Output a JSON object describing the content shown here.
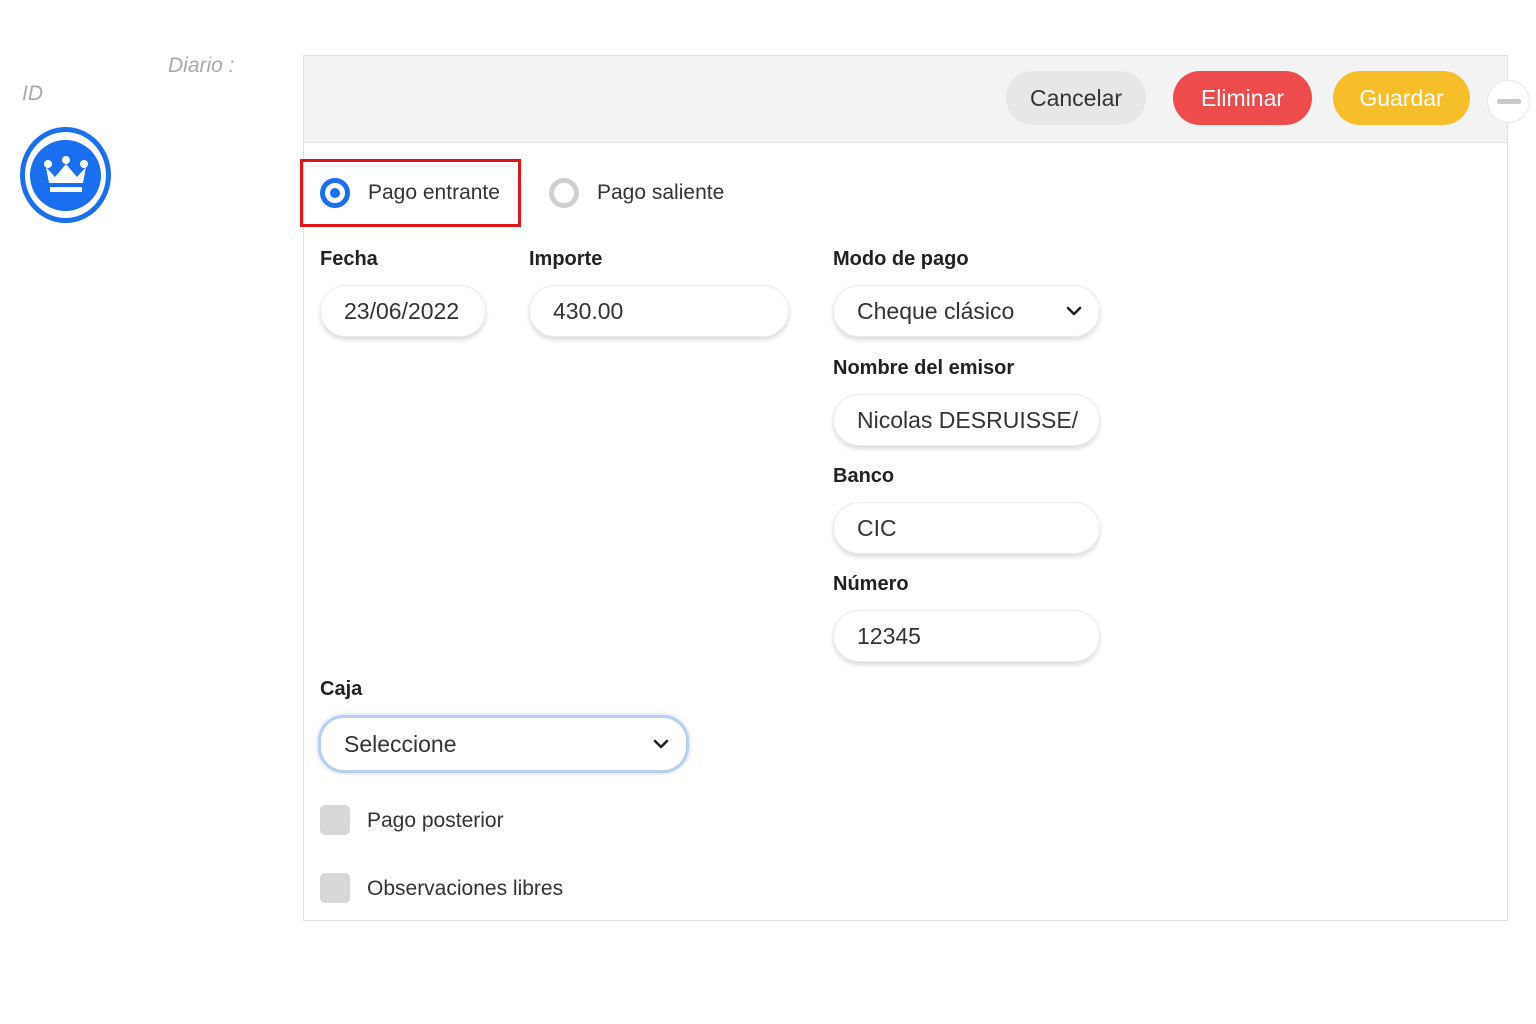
{
  "side": {
    "journal_label": "Diario :",
    "id_label": "ID",
    "badge_icon": "crown-icon"
  },
  "toolbar": {
    "cancel_label": "Cancelar",
    "delete_label": "Eliminar",
    "save_label": "Guardar",
    "collapse_icon": "minus-icon"
  },
  "payment_type": {
    "options": [
      {
        "label": "Pago entrante",
        "selected": true
      },
      {
        "label": "Pago saliente",
        "selected": false
      }
    ]
  },
  "fields": {
    "date": {
      "label": "Fecha",
      "value": "23/06/2022"
    },
    "amount": {
      "label": "Importe",
      "value": "430.00"
    },
    "payment_method": {
      "label": "Modo de pago",
      "value": "Cheque clásico"
    },
    "issuer_name": {
      "label": "Nombre del emisor",
      "value": "Nicolas DESRUISSE/"
    },
    "bank": {
      "label": "Banco",
      "value": "CIC"
    },
    "number": {
      "label": "Número",
      "value": "12345"
    },
    "cash_register": {
      "label": "Caja",
      "value": "Seleccione"
    }
  },
  "checkboxes": [
    {
      "label": "Pago posterior",
      "checked": false
    },
    {
      "label": "Observaciones libres",
      "checked": false
    }
  ],
  "colors": {
    "primary_blue": "#1a6ff0",
    "delete_red": "#ee4c4c",
    "save_yellow": "#f6bf2a",
    "highlight_red": "#e3131b"
  }
}
